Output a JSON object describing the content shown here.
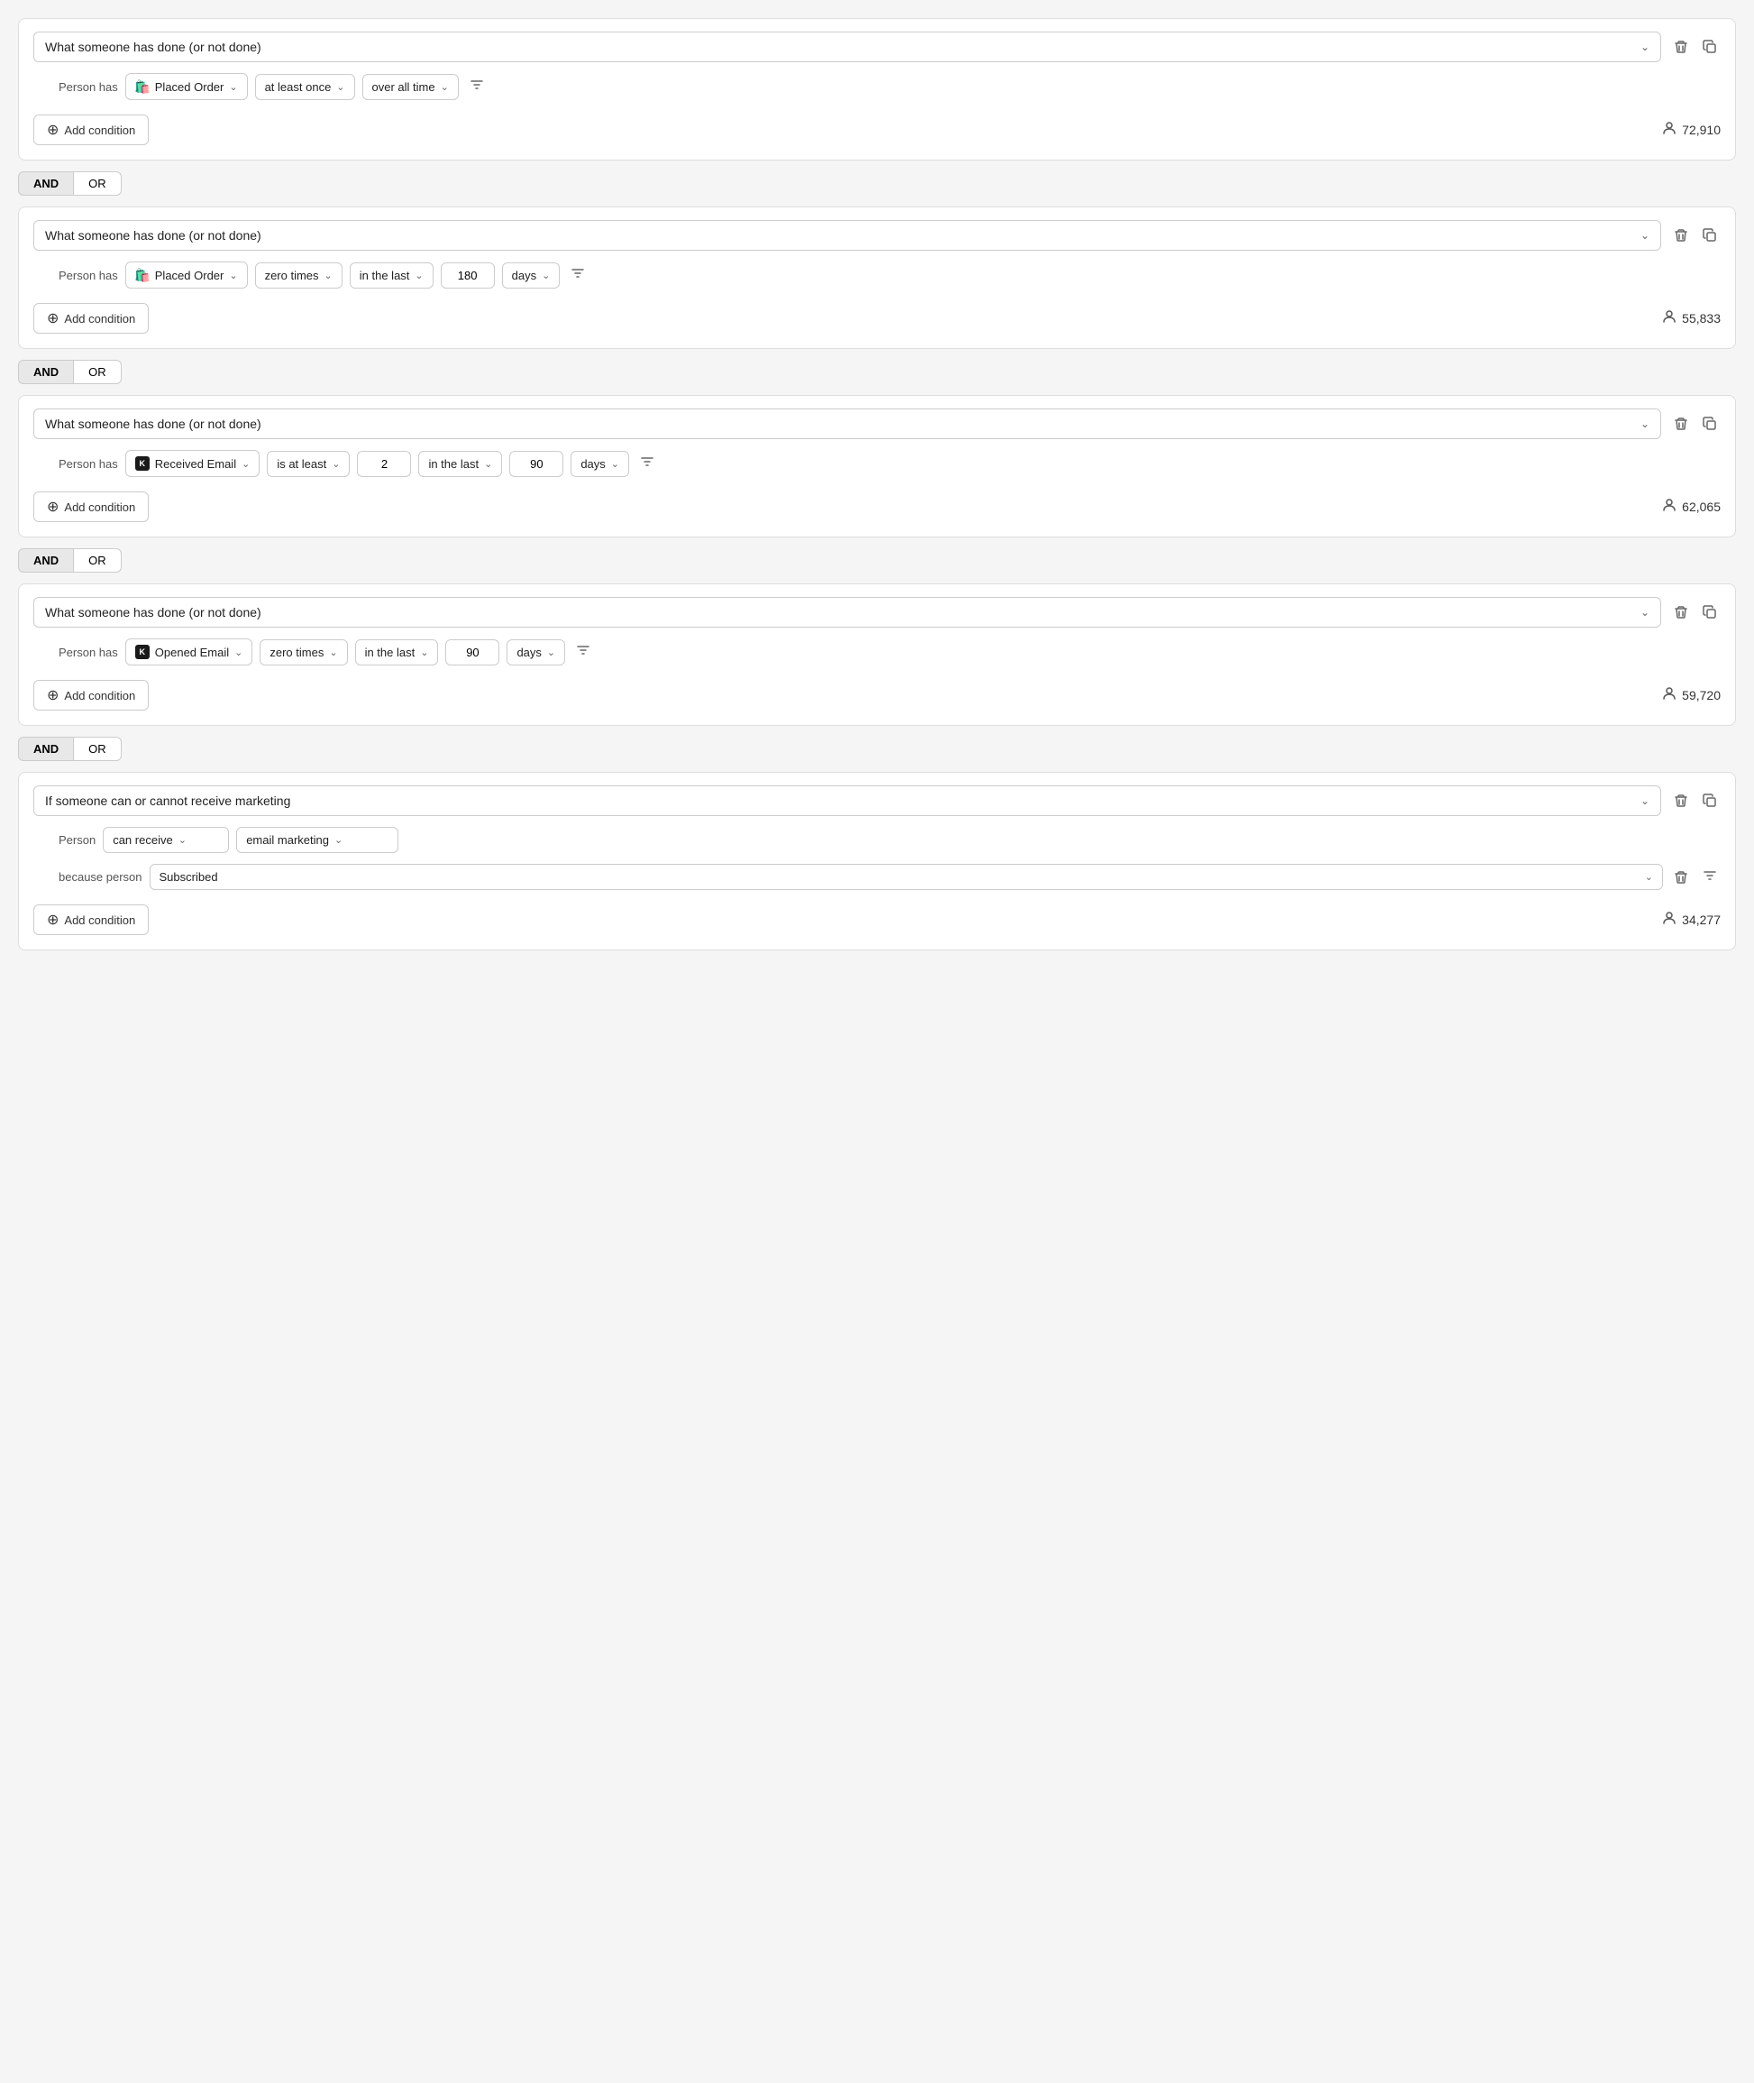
{
  "blocks": [
    {
      "id": "block1",
      "title": "What someone has done (or not done)",
      "condition_row": {
        "person_has": "Person has",
        "action_icon": "shopify",
        "action": "Placed Order",
        "frequency": "at least once",
        "time_range": "over all time",
        "has_number": false,
        "has_in_last": false
      },
      "count": "72,910",
      "add_condition_label": "Add condition"
    },
    {
      "id": "block2",
      "title": "What someone has done (or not done)",
      "condition_row": {
        "person_has": "Person has",
        "action_icon": "shopify",
        "action": "Placed Order",
        "frequency": "zero times",
        "has_in_last": true,
        "number_value": "180",
        "time_unit": "days"
      },
      "count": "55,833",
      "add_condition_label": "Add condition"
    },
    {
      "id": "block3",
      "title": "What someone has done (or not done)",
      "condition_row": {
        "person_has": "Person has",
        "action_icon": "klaviyo",
        "action": "Received Email",
        "frequency": "is at least",
        "has_count_input": true,
        "count_value": "2",
        "has_in_last": true,
        "number_value": "90",
        "time_unit": "days"
      },
      "count": "62,065",
      "add_condition_label": "Add condition"
    },
    {
      "id": "block4",
      "title": "What someone has done (or not done)",
      "condition_row": {
        "person_has": "Person has",
        "action_icon": "klaviyo",
        "action": "Opened Email",
        "frequency": "zero times",
        "has_in_last": true,
        "number_value": "90",
        "time_unit": "days"
      },
      "count": "59,720",
      "add_condition_label": "Add condition"
    },
    {
      "id": "block5",
      "title": "If someone can or cannot receive marketing",
      "condition_row": {
        "person_label": "Person",
        "can_receive": "can receive",
        "marketing_type": "email marketing",
        "because_person": "because person",
        "subscribed_status": "Subscribed"
      },
      "is_marketing_block": true,
      "count": "34,277",
      "add_condition_label": "Add condition"
    }
  ],
  "and_or": {
    "and_label": "AND",
    "or_label": "OR"
  },
  "icons": {
    "chevron_down": "⌄",
    "delete": "🗑",
    "copy": "⧉",
    "add": "+",
    "person_count": "👤",
    "filter": "⊲"
  }
}
